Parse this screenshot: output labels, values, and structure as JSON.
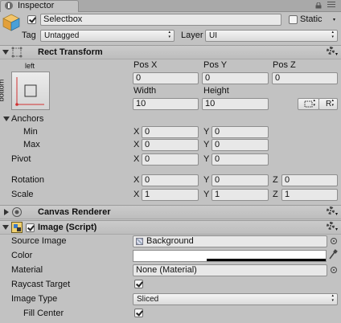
{
  "tab": {
    "title": "Inspector"
  },
  "object": {
    "active": true,
    "name": "Selectbox",
    "static_label": "Static",
    "static_checked": false,
    "tag_label": "Tag",
    "tag_value": "Untagged",
    "layer_label": "Layer",
    "layer_value": "UI"
  },
  "rect_transform": {
    "title": "Rect Transform",
    "anchor_top_label": "left",
    "anchor_side_label": "bottom",
    "col_labels": [
      "Pos X",
      "Pos Y",
      "Pos Z"
    ],
    "pos": [
      "0",
      "0",
      "0"
    ],
    "size_labels": [
      "Width",
      "Height"
    ],
    "size": [
      "10",
      "10"
    ],
    "raw_button_label": "R",
    "anchors_label": "Anchors",
    "min_label": "Min",
    "max_label": "Max",
    "min": {
      "x": "0",
      "y": "0"
    },
    "max": {
      "x": "0",
      "y": "0"
    },
    "pivot_label": "Pivot",
    "pivot": {
      "x": "0",
      "y": "0"
    },
    "rotation_label": "Rotation",
    "rotation": {
      "x": "0",
      "y": "0",
      "z": "0"
    },
    "scale_label": "Scale",
    "scale": {
      "x": "1",
      "y": "1",
      "z": "1"
    },
    "axis": {
      "x": "X",
      "y": "Y",
      "z": "Z"
    }
  },
  "canvas_renderer": {
    "title": "Canvas Renderer"
  },
  "image": {
    "title": "Image (Script)",
    "enabled": true,
    "source_label": "Source Image",
    "source_value": "Background",
    "color_label": "Color",
    "color": "#ffffff",
    "material_label": "Material",
    "material_value": "None (Material)",
    "raycast_label": "Raycast Target",
    "raycast": true,
    "type_label": "Image Type",
    "type_value": "Sliced",
    "fill_center_label": "Fill Center",
    "fill_center": true
  }
}
